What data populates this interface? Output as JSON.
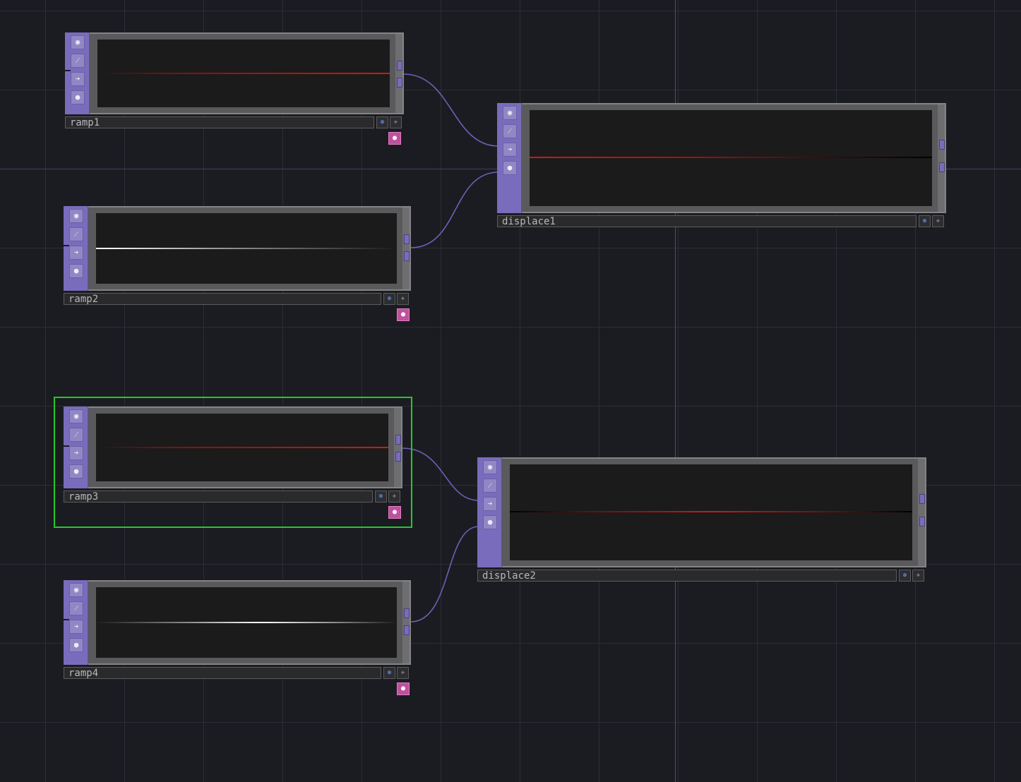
{
  "network": {
    "nodes": [
      {
        "name": "ramp1",
        "type": "ramp",
        "viewer": "on",
        "signal_color": "#d01818",
        "selected": false
      },
      {
        "name": "ramp2",
        "type": "ramp",
        "viewer": "on",
        "signal_color": "#ffffff",
        "selected": false
      },
      {
        "name": "ramp3",
        "type": "ramp",
        "viewer": "on",
        "signal_color": "#d01818",
        "selected": true
      },
      {
        "name": "ramp4",
        "type": "ramp",
        "viewer": "on",
        "signal_color": "#ffffff",
        "selected": false
      },
      {
        "name": "displace1",
        "type": "displace",
        "viewer": "off",
        "signal_color": "#d01818",
        "selected": false
      },
      {
        "name": "displace2",
        "type": "displace",
        "viewer": "off",
        "signal_color": "#d01818",
        "selected": false
      }
    ],
    "connections": [
      {
        "from": "ramp1",
        "to": "displace1",
        "input": 0
      },
      {
        "from": "ramp2",
        "to": "displace1",
        "input": 1
      },
      {
        "from": "ramp3",
        "to": "displace2",
        "input": 0
      },
      {
        "from": "ramp4",
        "to": "displace2",
        "input": 1
      }
    ],
    "flag_icons": [
      "bypass-icon",
      "lock-icon",
      "display-icon",
      "render-icon"
    ],
    "colors": {
      "background": "#1b1c21",
      "operator_family": "#7a6cbc",
      "wire": "#6a61b8",
      "selection": "#22c92a",
      "viewer_toggle": "#c0509d"
    }
  }
}
